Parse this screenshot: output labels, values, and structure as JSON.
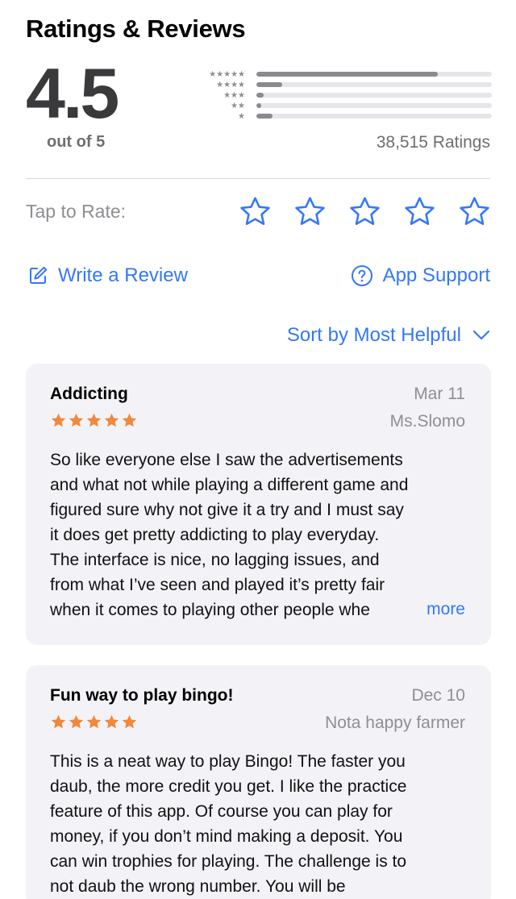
{
  "section": {
    "title": "Ratings & Reviews"
  },
  "rating": {
    "score": "4.5",
    "out_of": "out of 5",
    "total": "38,515 Ratings",
    "distribution": [
      {
        "stars": "★★★★★",
        "fraction": 0.77
      },
      {
        "stars": "★★★★",
        "fraction": 0.11
      },
      {
        "stars": "★★★",
        "fraction": 0.03
      },
      {
        "stars": "★★",
        "fraction": 0.02
      },
      {
        "stars": "★",
        "fraction": 0.07
      }
    ]
  },
  "tap_to_rate": {
    "label": "Tap to Rate:",
    "star_count": 5
  },
  "actions": {
    "write_review": "Write a Review",
    "app_support": "App Support"
  },
  "sort": {
    "label": "Sort by Most Helpful"
  },
  "colors": {
    "accent": "#3478f6",
    "review_star": "#f0893b",
    "card_bg": "#f2f2f7"
  },
  "reviews": [
    {
      "title": "Addicting",
      "date": "Mar 11",
      "author": "Ms.Slomo",
      "rating": 5,
      "lines": [
        "So like everyone else I saw the advertisements",
        "and what not while playing a different game and",
        "figured sure why not give it a try and I must say",
        "it does get pretty addicting to play everyday.",
        "The interface is nice, no lagging issues, and",
        "from what I’ve seen and played it’s pretty fair",
        "when it comes to playing other people whe"
      ],
      "more": "more"
    },
    {
      "title": "Fun way to play bingo!",
      "date": "Dec 10",
      "author": "Nota happy farmer",
      "rating": 5,
      "lines": [
        "This is a neat way to play Bingo!  The faster you",
        "daub, the more credit you get.  I like the practice",
        "feature of this app.  Of course you can play for",
        "money, if you don’t mind making a deposit. You",
        "can win trophies for playing. The challenge is to",
        "not daub the wrong number.  You will be"
      ]
    }
  ]
}
